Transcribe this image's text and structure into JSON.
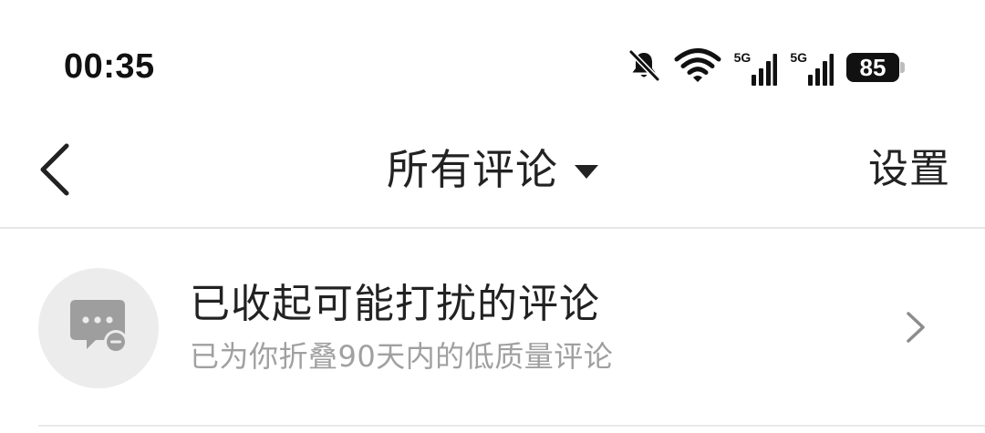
{
  "status_bar": {
    "time": "00:35",
    "network_1": "5G",
    "network_2": "5G",
    "battery": "85",
    "icons": [
      "bell-muted-icon",
      "wifi-icon",
      "cellular-signal-icon",
      "cellular-signal-icon",
      "battery-icon"
    ]
  },
  "nav": {
    "back_icon": "chevron-left-icon",
    "title": "所有评论",
    "title_dropdown_icon": "caret-down-icon",
    "settings_label": "设置"
  },
  "folded_comments": {
    "icon": "folded-comment-icon",
    "title": "已收起可能打扰的评论",
    "subtitle": "已为你折叠90天内的低质量评论",
    "chevron_icon": "chevron-right-icon"
  },
  "colors": {
    "text_primary": "#222222",
    "text_secondary": "#a0a0a0",
    "avatar_bg": "#ececec",
    "icon_gray": "#9e9e9e",
    "divider": "#e6e6e6"
  }
}
